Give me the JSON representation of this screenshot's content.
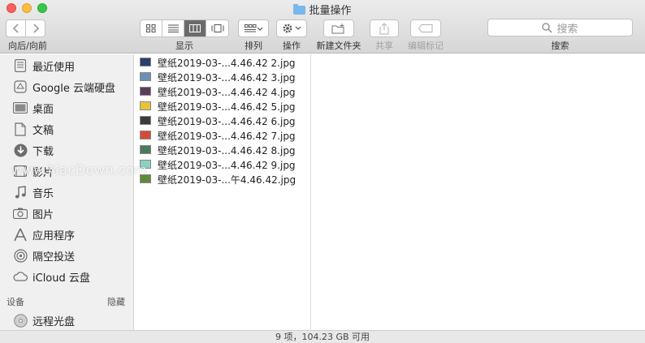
{
  "window": {
    "title": "批量操作"
  },
  "toolbar": {
    "nav_label": "向后/向前",
    "view_label": "显示",
    "arrange_label": "排列",
    "action_label": "操作",
    "new_folder_label": "新建文件夹",
    "share_label": "共享",
    "edit_tags_label": "编辑标记",
    "search_placeholder": "搜索",
    "search_label": "搜索"
  },
  "sidebar": {
    "items": [
      {
        "label": "最近使用",
        "icon": "recents-icon"
      },
      {
        "label": "Google 云端硬盘",
        "icon": "drive-icon"
      },
      {
        "label": "桌面",
        "icon": "desktop-icon"
      },
      {
        "label": "文稿",
        "icon": "documents-icon"
      },
      {
        "label": "下载",
        "icon": "downloads-icon"
      },
      {
        "label": "影片",
        "icon": "movies-icon"
      },
      {
        "label": "音乐",
        "icon": "music-icon"
      },
      {
        "label": "图片",
        "icon": "pictures-icon"
      },
      {
        "label": "应用程序",
        "icon": "applications-icon"
      },
      {
        "label": "隔空投送",
        "icon": "airdrop-icon"
      },
      {
        "label": "iCloud 云盘",
        "icon": "icloud-icon"
      }
    ],
    "devices_heading": "设备",
    "hide_label": "隐藏",
    "devices": [
      {
        "label": "远程光盘",
        "icon": "disc-icon"
      }
    ]
  },
  "files": [
    {
      "name": "壁纸2019-03-...4.46.42 2.jpg",
      "color": "#2a3f6b"
    },
    {
      "name": "壁纸2019-03-...4.46.42 3.jpg",
      "color": "#6c8fb3"
    },
    {
      "name": "壁纸2019-03-...4.46.42 4.jpg",
      "color": "#5a3d5c"
    },
    {
      "name": "壁纸2019-03-...4.46.42 5.jpg",
      "color": "#e8c23a"
    },
    {
      "name": "壁纸2019-03-...4.46.42 6.jpg",
      "color": "#3a3a3a"
    },
    {
      "name": "壁纸2019-03-...4.46.42 7.jpg",
      "color": "#d44b3a"
    },
    {
      "name": "壁纸2019-03-...4.46.42 8.jpg",
      "color": "#4a7a5a"
    },
    {
      "name": "壁纸2019-03-...4.46.42 9.jpg",
      "color": "#8fd0c0"
    },
    {
      "name": "壁纸2019-03-...午4.46.42.jpg",
      "color": "#5f8a3e"
    }
  ],
  "status": {
    "text": "9 项，104.23 GB 可用"
  },
  "watermark": "www.MacDown.com"
}
